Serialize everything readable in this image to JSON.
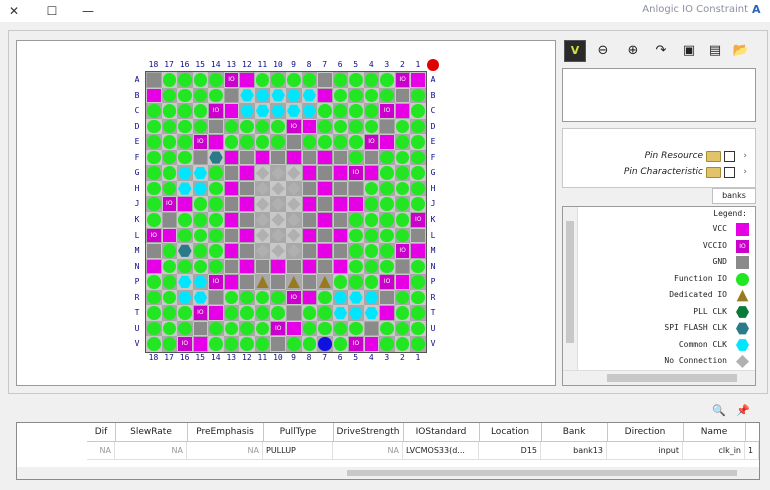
{
  "window": {
    "title": "Anlogic IO Constraint",
    "controls": {
      "close": "✕",
      "maximize": "☐",
      "minimize": "—"
    }
  },
  "board": {
    "col_numbers": [
      "18",
      "17",
      "16",
      "15",
      "14",
      "13",
      "12",
      "11",
      "10",
      "9",
      "8",
      "7",
      "6",
      "5",
      "4",
      "3",
      "2",
      "1"
    ],
    "row_letters": [
      "A",
      "B",
      "C",
      "D",
      "E",
      "F",
      "G",
      "H",
      "J",
      "K",
      "L",
      "M",
      "N",
      "P",
      "R",
      "T",
      "U",
      "V"
    ],
    "pin_label_vccio": "IO",
    "pin_label_io": "io"
  },
  "toolbar": {
    "verify": "V",
    "zoom_out": "⊖",
    "zoom_in": "⊕",
    "redo": "↷",
    "save": "▣",
    "save_as": "▤",
    "open": "📂"
  },
  "tree": {
    "items": [
      {
        "label": "Pin Resource"
      },
      {
        "label": "Pin Characteristic"
      }
    ],
    "tab": "banks"
  },
  "legend": {
    "title": "Legend:",
    "items": [
      {
        "label": "VCC",
        "color": "#e600e6",
        "shape": "square"
      },
      {
        "label": "VCCIO",
        "color": "#cc00cc",
        "shape": "square-io"
      },
      {
        "label": "GND",
        "color": "#8a8a8a",
        "shape": "square"
      },
      {
        "label": "Function IO",
        "color": "#22e622",
        "shape": "circle"
      },
      {
        "label": "Dedicated IO",
        "color": "#9a7a20",
        "shape": "triangle"
      },
      {
        "label": "PLL CLK",
        "color": "#0a7a3a",
        "shape": "hexagon"
      },
      {
        "label": "SPI FLASH CLK",
        "color": "#2a7a8a",
        "shape": "hexagon"
      },
      {
        "label": "Common CLK",
        "color": "#00e6ff",
        "shape": "hexagon"
      },
      {
        "label": "No Connection",
        "color": "#b0b0b0",
        "shape": "diamond"
      }
    ]
  },
  "table": {
    "columns": [
      "Name",
      "Direction",
      "Bank",
      "Location",
      "IOStandard",
      "DriveStrength",
      "PullType",
      "PreEmphasis",
      "SlewRate",
      "Dif"
    ],
    "rows": [
      [
        "clk_in",
        "input",
        "bank13",
        "D15",
        "LVCMOS33(d...",
        "NA",
        "PULLUP",
        "NA",
        "NA",
        "NA"
      ]
    ],
    "row_header": "1"
  }
}
